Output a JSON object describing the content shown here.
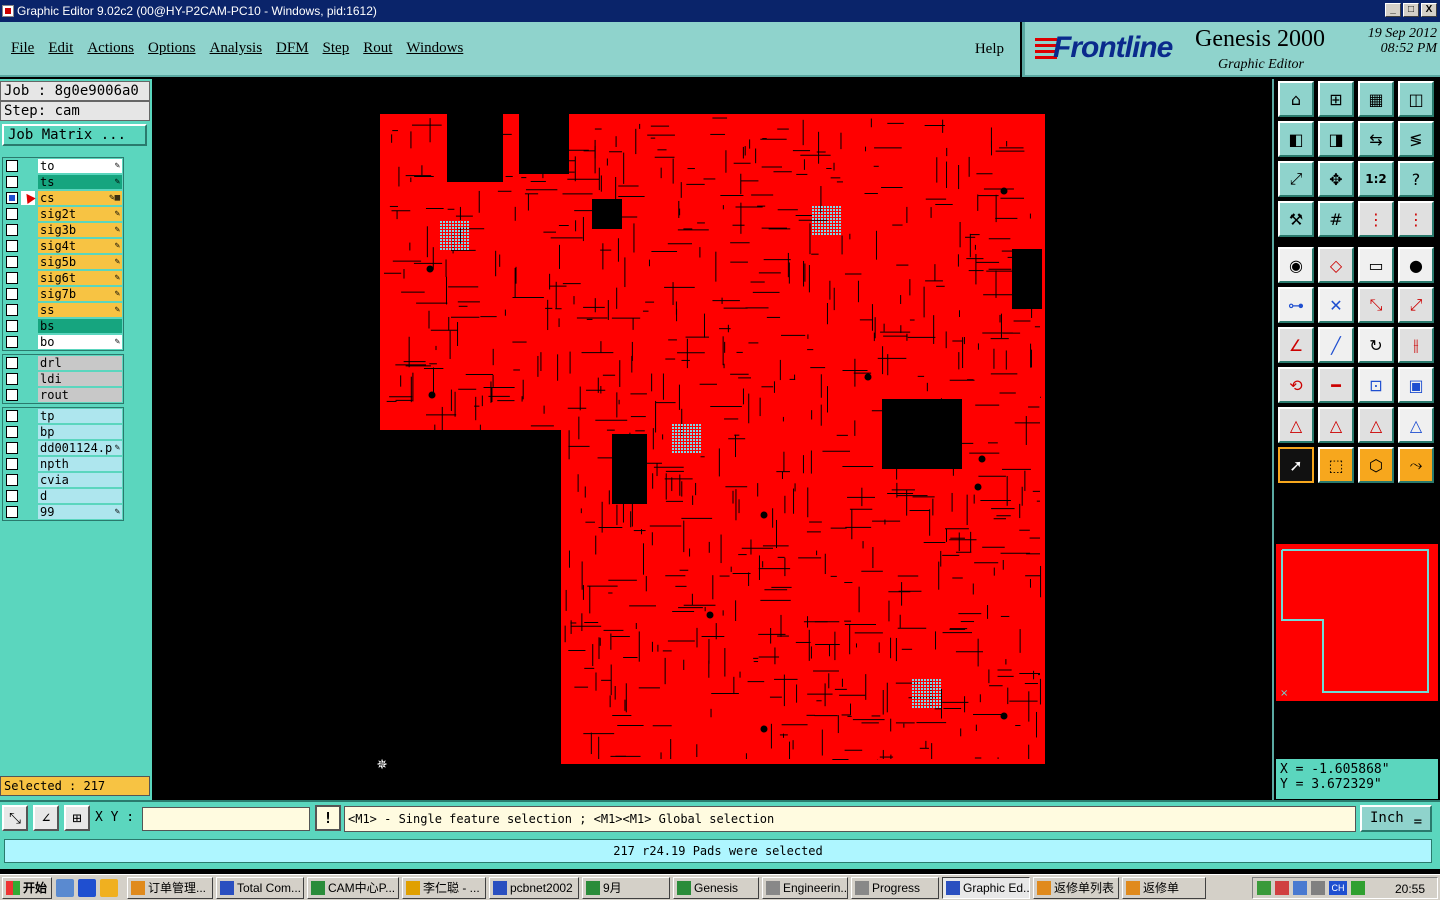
{
  "window": {
    "title": "Graphic Editor 9.02c2 (00@HY-P2CAM-PC10 - Windows, pid:1612)",
    "buttons": [
      "_",
      "□",
      "X"
    ]
  },
  "menu": {
    "items": [
      "File",
      "Edit",
      "Actions",
      "Options",
      "Analysis",
      "DFM",
      "Step",
      "Rout",
      "Windows"
    ],
    "help": "Help"
  },
  "brand": {
    "logo": "Frontline",
    "product": "Genesis 2000",
    "subtitle": "Graphic Editor",
    "date_line1": "19  Sep  2012",
    "date_line2": "08:52  PM"
  },
  "job": {
    "job_label": "Job  :  8g0e9006a0",
    "step_label": "Step:  cam",
    "matrix_button": "Job Matrix  ..."
  },
  "layers": {
    "board": [
      {
        "name": "to",
        "color": "white",
        "icon": "✎"
      },
      {
        "name": "ts",
        "color": "green",
        "icon": "✎"
      },
      {
        "name": "cs",
        "color": "orange",
        "icon": "✎▦",
        "active": true,
        "on": true
      },
      {
        "name": "sig2t",
        "color": "orange",
        "icon": "✎"
      },
      {
        "name": "sig3b",
        "color": "orange",
        "icon": "✎"
      },
      {
        "name": "sig4t",
        "color": "orange",
        "icon": "✎"
      },
      {
        "name": "sig5b",
        "color": "orange",
        "icon": "✎"
      },
      {
        "name": "sig6t",
        "color": "orange",
        "icon": "✎"
      },
      {
        "name": "sig7b",
        "color": "orange",
        "icon": "✎"
      },
      {
        "name": "ss",
        "color": "orange",
        "icon": "✎"
      },
      {
        "name": "bs",
        "color": "green",
        "icon": ""
      },
      {
        "name": "bo",
        "color": "white",
        "icon": "✎"
      }
    ],
    "drill": [
      {
        "name": "drl",
        "color": "gray",
        "icon": ""
      },
      {
        "name": "ldi",
        "color": "gray",
        "icon": ""
      },
      {
        "name": "rout",
        "color": "gray",
        "icon": ""
      }
    ],
    "misc": [
      {
        "name": "tp",
        "color": "cyan",
        "icon": ""
      },
      {
        "name": "bp",
        "color": "cyan",
        "icon": ""
      },
      {
        "name": "dd001124.p",
        "color": "cyan",
        "icon": "✎"
      },
      {
        "name": "npth",
        "color": "cyan",
        "icon": ""
      },
      {
        "name": "cvia",
        "color": "cyan",
        "icon": ""
      },
      {
        "name": "d",
        "color": "cyan",
        "icon": ""
      },
      {
        "name": "99",
        "color": "cyan",
        "icon": "✎"
      }
    ]
  },
  "selected_label": "Selected : 217",
  "coords": {
    "x": "X = -1.605868\"",
    "y": "Y =  3.672329\""
  },
  "command": {
    "xy_label": "X Y :",
    "xy_value": "",
    "exclamation": "!",
    "prompt": "<M1> - Single feature selection ; <M1><M1> Global selection",
    "unit": "Inch",
    "unit_icon": "="
  },
  "status_message": "217 r24.19 Pads were selected",
  "taskbar": {
    "start": "开始",
    "tasks": [
      {
        "label": "订单管理...",
        "color": "#e08a1c"
      },
      {
        "label": "Total Com...",
        "color": "#2a4fc0"
      },
      {
        "label": "CAM中心P...",
        "color": "#2a8c3a"
      },
      {
        "label": "李仁聪 - ...",
        "color": "#e0a000"
      },
      {
        "label": "pcbnet2002",
        "color": "#2a4fc0"
      },
      {
        "label": "9月",
        "color": "#2a8c3a"
      },
      {
        "label": "Genesis",
        "color": "#2a8c3a"
      },
      {
        "label": "Engineerin...",
        "color": "#888888"
      },
      {
        "label": "Progress",
        "color": "#888888"
      },
      {
        "label": "Graphic Ed...",
        "color": "#2a4fc0",
        "active": true
      },
      {
        "label": "返修单列表",
        "color": "#e08a1c"
      },
      {
        "label": "返修单",
        "color": "#e08a1c"
      }
    ],
    "clock": "20:55",
    "lang": "CH"
  },
  "colors": {
    "board_fill": "#ff0000",
    "panel_teal": "#8fd3cc",
    "panel_green": "#5bd6be",
    "highlight_orange": "#f7c343"
  }
}
